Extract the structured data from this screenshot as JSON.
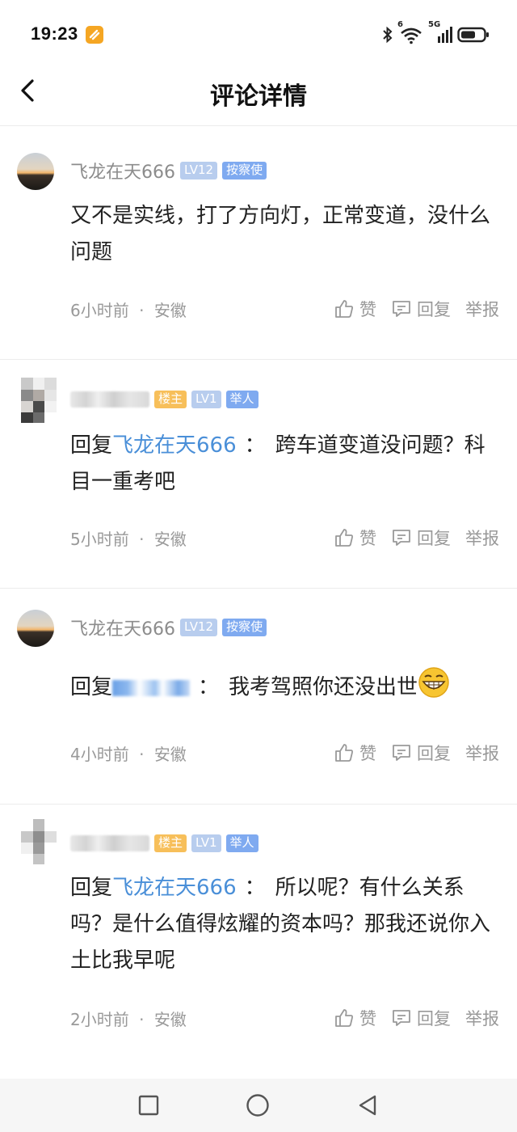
{
  "status_bar": {
    "time": "19:23",
    "network": "5G",
    "wifi_tag": "6"
  },
  "header": {
    "title": "评论详情"
  },
  "comments": [
    {
      "username": "飞龙在天666",
      "level": "LV12",
      "role": "按察使",
      "text": "又不是实线，打了方向灯，正常变道，没什么问题",
      "time": "6小时前",
      "location": "安徽",
      "actions": {
        "like": "赞",
        "reply": "回复",
        "report": "举报"
      }
    },
    {
      "host_badge": "楼主",
      "level": "LV1",
      "role": "举人",
      "reply_prefix": "回复",
      "reply_to": "飞龙在天666",
      "colon": "：",
      "text": "跨车道变道没问题？科目一重考吧",
      "time": "5小时前",
      "location": "安徽",
      "actions": {
        "like": "赞",
        "reply": "回复",
        "report": "举报"
      }
    },
    {
      "username": "飞龙在天666",
      "level": "LV12",
      "role": "按察使",
      "reply_prefix": "回复",
      "colon": "：",
      "text": "我考驾照你还没出世",
      "emoji": "grinning-emoji",
      "time": "4小时前",
      "location": "安徽",
      "actions": {
        "like": "赞",
        "reply": "回复",
        "report": "举报"
      }
    },
    {
      "host_badge": "楼主",
      "level": "LV1",
      "role": "举人",
      "reply_prefix": "回复",
      "reply_to": "飞龙在天666",
      "colon": "：",
      "text": "所以呢？有什么关系吗？是什么值得炫耀的资本吗？那我还说你入土比我早呢",
      "time": "2小时前",
      "location": "安徽",
      "actions": {
        "like": "赞",
        "reply": "回复",
        "report": "举报"
      }
    }
  ],
  "separator": "·",
  "colors": {
    "link": "#4a8fd8",
    "muted": "#999999",
    "badge_host": "#f7bf5a",
    "badge_role": "#7faaf0",
    "badge_lv": "#b8cdee"
  }
}
